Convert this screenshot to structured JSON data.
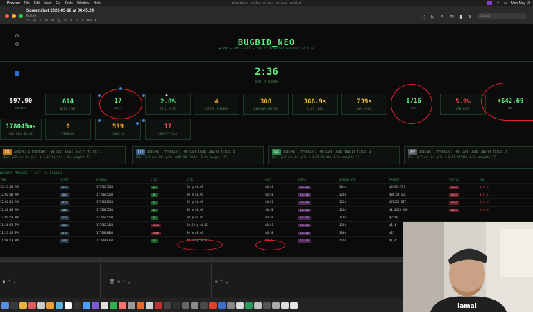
{
  "menubar": {
    "app": "Preview",
    "items": [
      "File",
      "Edit",
      "View",
      "Go",
      "Tools",
      "Window",
      "Help"
    ],
    "window_title": "BBG BUG4 - Profile: Hot-Rod - Preview - Untitled",
    "datetime": "Mon May 18"
  },
  "titlebar": {
    "doc_title": "Screenshot 2026-05-18 at 00.45.24",
    "doc_sub": "Edited",
    "tools": [
      "▭",
      "⊡",
      "⌕",
      "⊖",
      "⊕",
      "⎙",
      "✎",
      "▾",
      "↺",
      "▾",
      "Aa",
      "▾"
    ],
    "search_placeholder": "Search"
  },
  "dashboard": {
    "title": "BUGBID_NEO",
    "subtitle": "● btc + eth + sol + xrp // frontier watcher // live",
    "timer": "2:36",
    "timer_label": "NEXT IN WINDOW"
  },
  "stats_row1": [
    {
      "value": "$97.90",
      "label": "BALANCE",
      "color": "#f2f2f2"
    },
    {
      "value": "614",
      "label": "BIDS SENT",
      "color": "#5df07f"
    },
    {
      "value": "17",
      "label": "FILLS",
      "color": "#5df07f"
    },
    {
      "value": "2.8%",
      "label": "FILL RATE",
      "color": "#5df07f"
    },
    {
      "value": "4",
      "label": "ACTIVE WINDOWS",
      "color": "#f2c13c"
    },
    {
      "value": "308",
      "label": "WINDOWS CHECKS",
      "color": "#f6a332"
    },
    {
      "value": "366.9s",
      "label": "LAST LEAD",
      "color": "#f2c13c"
    },
    {
      "value": "739s",
      "label": "AVG LEAD",
      "color": "#f2c13c"
    },
    {
      "value": "1/16",
      "label": "W/L",
      "color": "#5df07f"
    },
    {
      "value": "5.9%",
      "label": "WIN RATE",
      "color": "#f04b56"
    },
    {
      "value": "+$42.69",
      "label": "PNL",
      "color": "#5df07f"
    }
  ],
  "stats_row2": [
    {
      "value": "178045ms",
      "label": "AVG FILL DELAY",
      "color": "#5df07f"
    },
    {
      "value": "0",
      "label": "PENDING",
      "color": "#f6a332"
    },
    {
      "value": "599",
      "label": "CANCELS",
      "color": "#f6a332"
    },
    {
      "value": "17",
      "label": "UNMET FILLS",
      "color": "#f04b56"
    }
  ],
  "markets": [
    {
      "asset": "BTC",
      "color": "#c27a12",
      "line1": "active: 1 frontier: -0m last lead: 547.7s fills: 3",
      "line2": "W/L: 1/2 wr: 0% pnl: $-1.30 filth: 1.0% caught: 77"
    },
    {
      "asset": "ETH",
      "color": "#3b5d8a",
      "line1": "active: 1 frontier: -0m last lead: 366.9s fills: 5",
      "line2": "W/L: 1/4 wr: 20% pnl: +$47.50 filth: 2.2% caught: 77"
    },
    {
      "asset": "SOL",
      "color": "#2c8a4a",
      "line1": "active: 1 frontier: -0m last lead: 660.1s fills: 3",
      "line2": "W/L: 2/3 wr: 0% pnl: $-1.50 filth: 1.9% caught: 77"
    },
    {
      "asset": "XRP",
      "color": "#555c66",
      "line1": "active: 1 frontier: -0m last lead: 366.9s fills: 7",
      "line2": "W/L: 0/7 wr: 0% pnl: $-2.31 filth: 4.5% caught: 77"
    }
  ],
  "trades": {
    "title": "RECENT TRADES (LAST 15 FILLS)",
    "headers": [
      "TIME",
      "ASSET",
      "WINDOW",
      "SIDE",
      "SIZE",
      "COST",
      "ORDER",
      "WINDOW POS",
      "MARKET",
      "STATUS",
      "PNL"
    ],
    "rows": [
      {
        "time": "12:37:24 AM",
        "asset": "ETH",
        "window": "1779657300",
        "side": "UP",
        "size": "50 @ $0.01",
        "cost": "$0.50",
        "order": "FILLED",
        "pos": "144s",
        "market": "$2182 ETH",
        "status": "LOSS",
        "pnl": "$-0.51"
      },
      {
        "time": "12:02:08 AM",
        "asset": "SOL",
        "window": "1779655200",
        "side": "UP",
        "size": "50 @ $0.01",
        "cost": "$0.50",
        "order": "FILLED",
        "pos": "128s",
        "market": "$86.59 SOL",
        "status": "LOSS",
        "pnl": "$-0.51"
      },
      {
        "time": "12:02:13 AM",
        "asset": "BTC",
        "window": "1779655200",
        "side": "UP",
        "size": "50 @ $0.01",
        "cost": "$0.50",
        "order": "FILLED",
        "pos": "122s",
        "market": "$78235 BTC",
        "status": "LOSS",
        "pnl": "$-0.51"
      },
      {
        "time": "12:02:08 AM",
        "asset": "XRP",
        "window": "1779655200",
        "side": "UP",
        "size": "50 @ $0.01",
        "cost": "$0.50",
        "order": "FILLED",
        "pos": "128s",
        "market": "$1.4163 XRP",
        "status": "LOSS",
        "pnl": "$-0.51"
      },
      {
        "time": "12:01:58 AM",
        "asset": "ETH",
        "window": "1779655200",
        "side": "UP",
        "size": "50 @ $0.01",
        "cost": "$0.50",
        "order": "FILLED",
        "pos": "118s",
        "market": "$2186",
        "status": "",
        "pnl": ""
      },
      {
        "time": "11:36:50 PM",
        "asset": "XRP",
        "window": "1779653400",
        "side": "DOWN",
        "size": "50.52 @ $0.01",
        "cost": "$0.51",
        "order": "FILLED",
        "pos": "120s",
        "market": "$1.4",
        "status": "",
        "pnl": ""
      },
      {
        "time": "11:33:16 PM",
        "asset": "ETH",
        "window": "1779648800",
        "side": "DOWN",
        "size": "50 @ $0.01",
        "cost": "$0.50",
        "order": "FILLED",
        "pos": "190s",
        "market": "$21",
        "status": "",
        "pnl": ""
      },
      {
        "time": "11:08:19 PM",
        "asset": "XRP",
        "window": "1779648300",
        "side": "UP",
        "size": "29.35 @ $0.01",
        "cost": "$0.23",
        "order": "FILLED",
        "pos": "219s",
        "market": "$1.4",
        "status": "",
        "pnl": ""
      }
    ]
  }
}
